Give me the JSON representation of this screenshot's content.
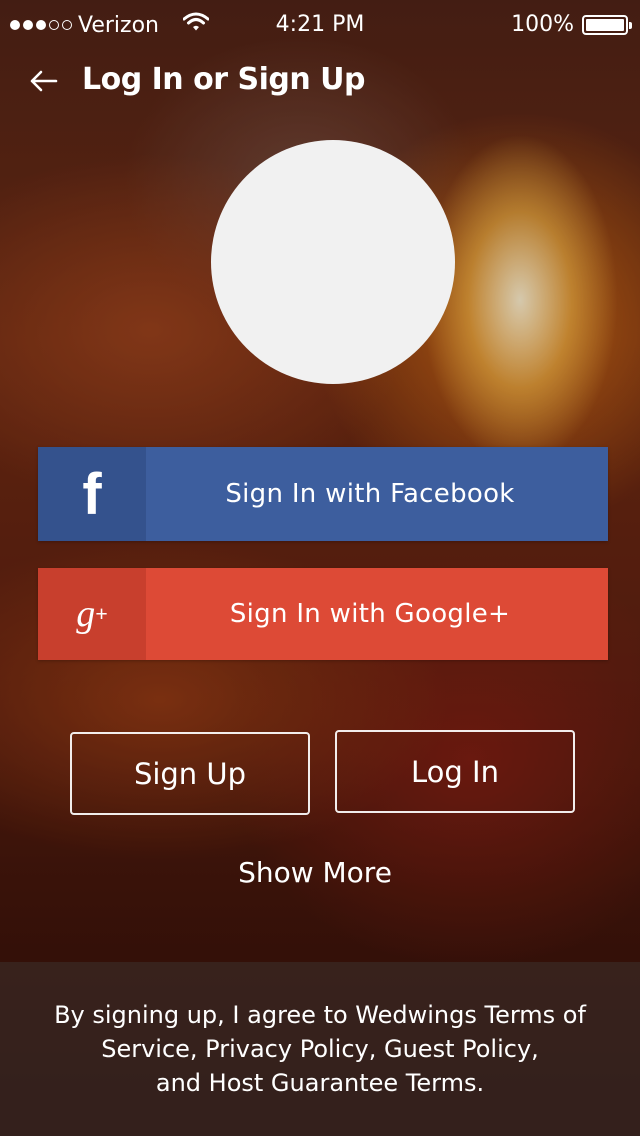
{
  "status_bar": {
    "carrier": "Verizon",
    "time": "4:21 PM",
    "battery": "100%",
    "signal_bars_filled": 3,
    "signal_bars_total": 5
  },
  "nav": {
    "title": "Log In or Sign Up"
  },
  "social": {
    "facebook": {
      "icon_text": "f",
      "label": "Sign In with Facebook",
      "color": "#3d5e9e"
    },
    "google": {
      "icon_text": "g",
      "icon_sup": "+",
      "label": "Sign In with Google+",
      "color": "#dd4a36"
    }
  },
  "buttons": {
    "sign_up": "Sign Up",
    "log_in": "Log In",
    "show_more": "Show More"
  },
  "legal": {
    "line1": "By signing up, I agree to Wedwings Terms of",
    "line2": "Service, Privacy Policy, Guest Policy,",
    "line3": "and Host Guarantee Terms."
  },
  "icons": {
    "back": "back-arrow-icon",
    "wifi": "wifi-icon",
    "battery": "battery-icon",
    "facebook": "facebook-icon",
    "google": "google-plus-icon"
  }
}
